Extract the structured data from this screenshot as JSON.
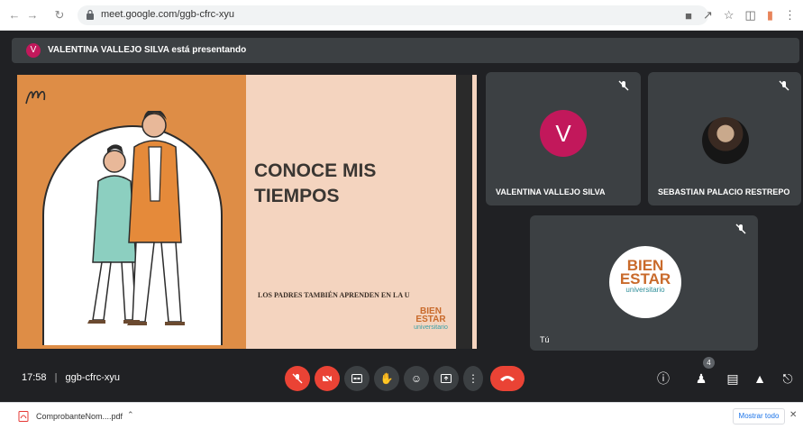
{
  "browser": {
    "url": "meet.google.com/ggb-cfrc-xyu"
  },
  "presenter_bar": {
    "avatar_letter": "V",
    "text": "VALENTINA VALLEJO SILVA está presentando"
  },
  "slide": {
    "title": "CONOCE MIS TIEMPOS",
    "subtitle": "LOS PADRES TAMBIÉN APRENDEN EN LA U",
    "logo_top": "BIEN",
    "logo_mid": "ESTAR",
    "logo_bottom": "universitario"
  },
  "participants": [
    {
      "name": "VALENTINA VALLEJO SILVA",
      "avatar_letter": "V"
    },
    {
      "name": "SEBASTIAN PALACIO RESTREPO"
    },
    {
      "name": "Tú",
      "logo_top": "BIEN",
      "logo_mid": "ESTAR",
      "logo_bottom": "universitario"
    }
  ],
  "toolbar": {
    "time": "17:58",
    "separator": "|",
    "meeting_code": "ggb-cfrc-xyu",
    "people_count": "4"
  },
  "downloads": {
    "file_name": "ComprobanteNom....pdf",
    "show_all": "Mostrar todo"
  },
  "colors": {
    "meet_bg": "#202124",
    "tile_bg": "#3c4043",
    "danger": "#ea4335",
    "avatar_pink": "#c2185b",
    "slide_orange": "#de8d46",
    "slide_peach": "#f4d4bf"
  }
}
